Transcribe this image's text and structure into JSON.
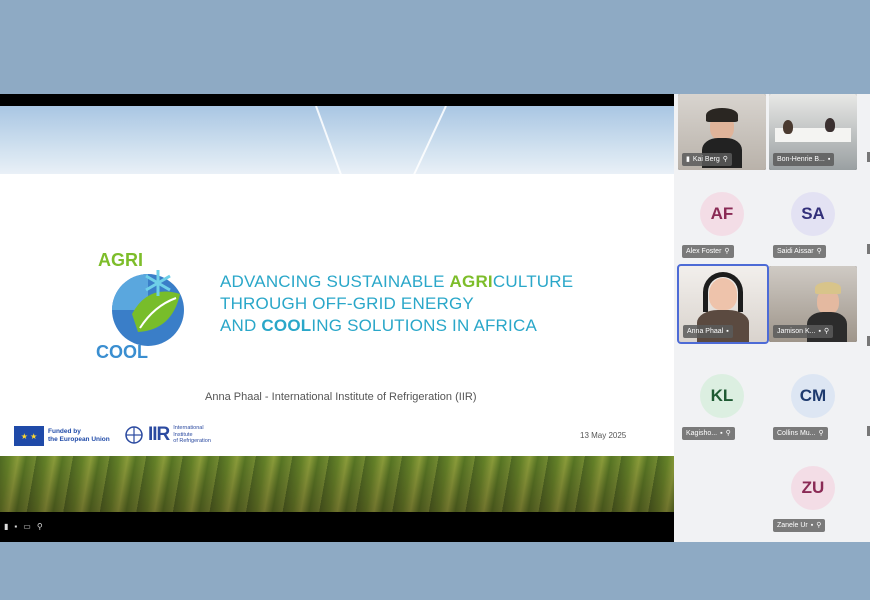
{
  "slide": {
    "headline_lines": [
      {
        "pre": "ADVANCING SUSTAINABLE ",
        "em": "AGRI",
        "post": "CULTURE"
      },
      {
        "pre": "THROUGH OFF-GRID ENERGY",
        "em": "",
        "post": ""
      },
      {
        "pre": "AND ",
        "em": "COOL",
        "post": "ING SOLUTIONS IN AFRICA"
      }
    ],
    "logo_top": "AGRI",
    "logo_bottom": "COOL",
    "presenter": "Anna Phaal - International Institute of Refrigeration (IIR)",
    "eu_line1": "Funded by",
    "eu_line2": "the European Union",
    "iir_mark": "IIR",
    "iir_line1": "International",
    "iir_line2": "Institute",
    "iir_line3": "of Refrigeration",
    "date": "13 May 2025"
  },
  "participants": [
    {
      "name": "Kai Berg",
      "type": "video"
    },
    {
      "name": "Bon-Henrie B...",
      "type": "video"
    },
    {
      "initials": "AF",
      "name": "Alex Foster",
      "type": "avatar",
      "bg": "#f3dde6",
      "fg": "#8a2a55"
    },
    {
      "initials": "SA",
      "name": "Saidi Aissar",
      "type": "avatar",
      "bg": "#e3e2f3",
      "fg": "#33307a"
    },
    {
      "name": "Anna Phaal",
      "type": "video"
    },
    {
      "name": "Jamison K...",
      "type": "video"
    },
    {
      "initials": "KL",
      "name": "Kagisho...",
      "type": "avatar",
      "bg": "#dcefe1",
      "fg": "#1e5a32"
    },
    {
      "initials": "CM",
      "name": "Collins Mu...",
      "type": "avatar",
      "bg": "#dde6f3",
      "fg": "#1e3a6e"
    },
    {
      "initials": "ZU",
      "name": "Zanele Ur",
      "type": "avatar",
      "bg": "#f3dde6",
      "fg": "#8a2a55"
    }
  ],
  "colors": {
    "accent_teal": "#2aa7c9",
    "accent_green": "#7dbd2a",
    "active_speaker_border": "#4d6bd6",
    "page_bg": "#8eaac4"
  },
  "icons": [
    "mic-muted-icon",
    "camera-icon",
    "signal-icon"
  ]
}
